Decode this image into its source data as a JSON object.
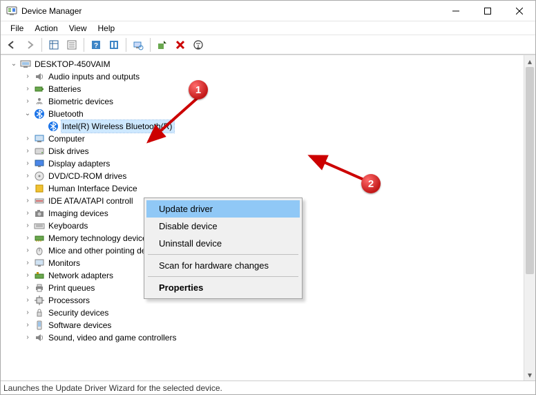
{
  "window": {
    "title": "Device Manager"
  },
  "menu": {
    "file": "File",
    "action": "Action",
    "view": "View",
    "help": "Help"
  },
  "tree": {
    "root": "DESKTOP-450VAIM",
    "audio": "Audio inputs and outputs",
    "batteries": "Batteries",
    "biometric": "Biometric devices",
    "bluetooth": "Bluetooth",
    "bluetooth_child": "Intel(R) Wireless Bluetooth(R)",
    "computer": "Computer",
    "disk": "Disk drives",
    "display": "Display adapters",
    "dvd": "DVD/CD-ROM drives",
    "hid": "Human Interface Device",
    "ide": "IDE ATA/ATAPI controll",
    "imaging": "Imaging devices",
    "keyboards": "Keyboards",
    "memory": "Memory technology devices",
    "mice": "Mice and other pointing devices",
    "monitors": "Monitors",
    "network": "Network adapters",
    "print": "Print queues",
    "processors": "Processors",
    "security": "Security devices",
    "software": "Software devices",
    "sound": "Sound, video and game controllers"
  },
  "context_menu": {
    "update": "Update driver",
    "disable": "Disable device",
    "uninstall": "Uninstall device",
    "scan": "Scan for hardware changes",
    "properties": "Properties"
  },
  "annotations": {
    "badge1": "1",
    "badge2": "2"
  },
  "status": "Launches the Update Driver Wizard for the selected device."
}
